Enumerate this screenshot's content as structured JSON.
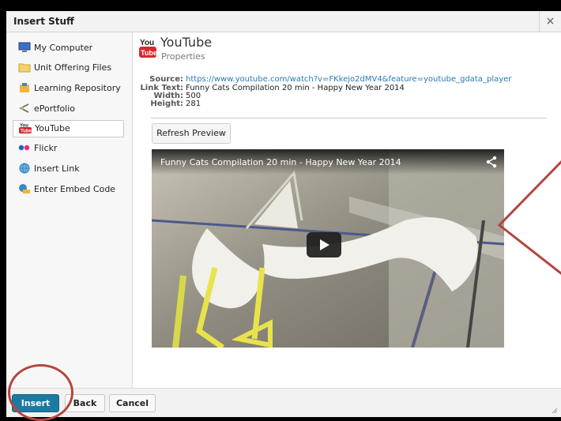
{
  "dialog": {
    "title": "Insert Stuff",
    "close_label": "×"
  },
  "sidebar": {
    "items": [
      {
        "label": "My Computer",
        "icon": "computer-icon"
      },
      {
        "label": "Unit Offering Files",
        "icon": "folder-icon"
      },
      {
        "label": "Learning Repository",
        "icon": "repository-icon"
      },
      {
        "label": "ePortfolio",
        "icon": "eportfolio-icon"
      },
      {
        "label": "YouTube",
        "icon": "youtube-icon",
        "active": true
      },
      {
        "label": "Flickr",
        "icon": "flickr-icon"
      },
      {
        "label": "Insert Link",
        "icon": "globe-link-icon"
      },
      {
        "label": "Enter Embed Code",
        "icon": "embed-code-icon"
      }
    ]
  },
  "content": {
    "heading": "YouTube",
    "subheading": "Properties",
    "properties": {
      "source_label": "Source:",
      "source_value": "https://www.youtube.com/watch?v=FKkejo2dMV4&feature=youtube_gdata_player",
      "link_text_label": "Link Text:",
      "link_text_value": "Funny Cats Compilation 20 min - Happy New Year 2014",
      "width_label": "Width:",
      "width_value": "500",
      "height_label": "Height:",
      "height_value": "281"
    },
    "refresh_label": "Refresh Preview",
    "video": {
      "title": "Funny Cats Compilation 20 min - Happy New Year 2014"
    }
  },
  "footer": {
    "insert_label": "Insert",
    "back_label": "Back",
    "cancel_label": "Cancel"
  },
  "colors": {
    "primary_button": "#1d7aa3",
    "annotation": "#b5453e",
    "link": "#2a7ab0"
  }
}
